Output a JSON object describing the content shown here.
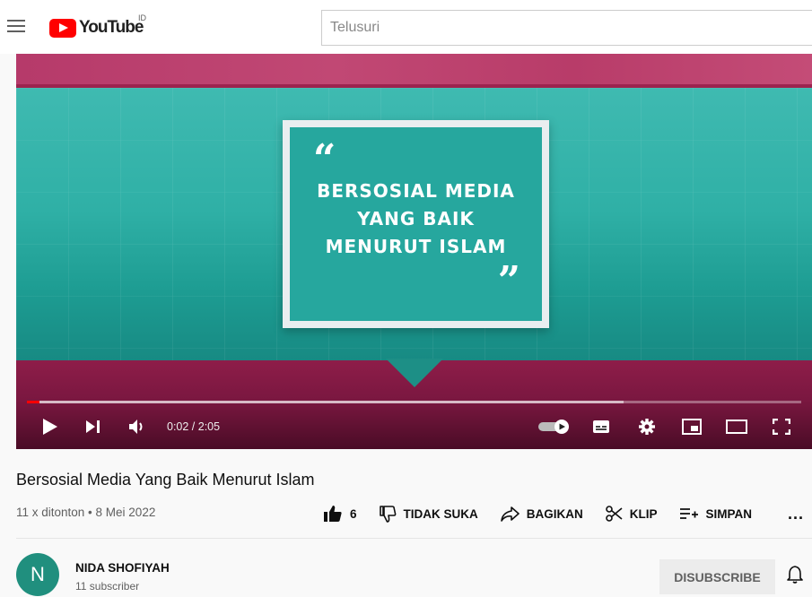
{
  "header": {
    "logo_text": "YouTube",
    "country_code": "ID",
    "search_placeholder": "Telusuri"
  },
  "video": {
    "slide_text_line1": "BERSOSIAL MEDIA",
    "slide_text_line2": "YANG BAIK",
    "slide_text_line3": "MENURUT ISLAM",
    "time_display": "0:02 / 2:05",
    "progress_played_fraction": 0.016,
    "progress_buffered_fraction": 0.77
  },
  "info": {
    "title": "Bersosial Media Yang Baik Menurut Islam",
    "meta": "11 x ditonton • 8 Mei 2022",
    "like_count": "6",
    "dislike_label": "TIDAK SUKA",
    "share_label": "BAGIKAN",
    "clip_label": "KLIP",
    "save_label": "SIMPAN",
    "more_label": "..."
  },
  "channel": {
    "avatar_letter": "N",
    "name": "NIDA SHOFIYAH",
    "subscribers": "11 subscriber",
    "unsubscribe_label": "DISUBSCRIBE"
  },
  "colors": {
    "brand_red": "#ff0000",
    "avatar_bg": "#208f7e",
    "progress_red": "#ff0000"
  }
}
